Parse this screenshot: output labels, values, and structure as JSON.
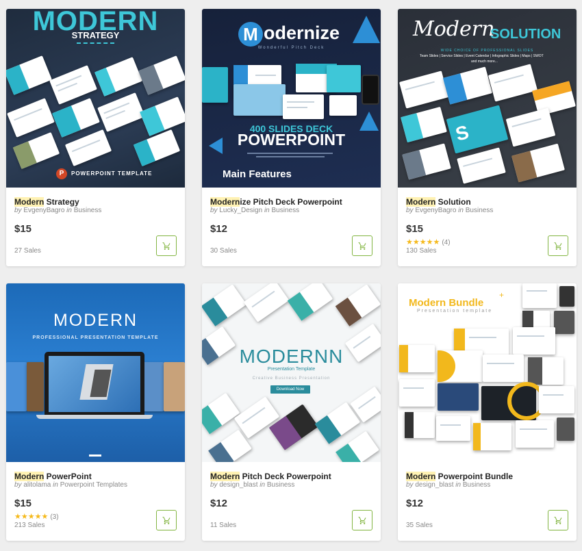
{
  "accent_color": "#82b541",
  "cards": [
    {
      "highlight": "Modern",
      "title_rest": " Strategy",
      "author": "EvgenyBagro",
      "category": "Business",
      "price": "$15",
      "sales": "27 Sales",
      "thumb": {
        "heading": "MODERN",
        "sub": "STRATEGY",
        "footer": "POWERPOINT TEMPLATE"
      }
    },
    {
      "highlight": "Modern",
      "title_rest": "ize Pitch Deck Powerpoint",
      "author": "Lucky_Design",
      "category": "Business",
      "price": "$12",
      "sales": "30 Sales",
      "thumb": {
        "logo": "M",
        "heading": "odernize",
        "sub": "Wonderful Pitch Deck",
        "banner1": "400 SLIDES DECK",
        "banner2": "POWERPOINT",
        "footer": "Main Features"
      }
    },
    {
      "highlight": "Modern",
      "title_rest": " Solution",
      "author": "EvgenyBagro",
      "category": "Business",
      "price": "$15",
      "rating": 5,
      "rating_count": "(4)",
      "sales": "130 Sales",
      "thumb": {
        "heading": "Modern",
        "heading2": "SOLUTION",
        "sub": "WIDE CHOICE OF PROFESSIONAL SLIDES",
        "line1": "Team Slides | Service Slides | Event Calendar | Infographic Slides | Maps | SWOT",
        "line2": "and much more..."
      }
    },
    {
      "highlight": "Modern",
      "title_rest": " PowerPoint",
      "author": "alitolama",
      "category": "Powerpoint Templates",
      "price": "$15",
      "rating": 5,
      "rating_count": "(3)",
      "sales": "213 Sales",
      "thumb": {
        "heading": "MODERN",
        "sub": "PROFESSIONAL PRESENTATION TEMPLATE"
      }
    },
    {
      "highlight": "Modern",
      "title_rest": " Pitch Deck Powerpoint",
      "author": "design_blast",
      "category": "Business",
      "price": "$12",
      "sales": "11 Sales",
      "thumb": {
        "heading": "MODERNN",
        "sub": "Presentation Template",
        "tagline": "Creative Business Presentation",
        "button": "Download Now"
      }
    },
    {
      "highlight": "Modern",
      "title_rest": " Powerpoint Bundle",
      "author": "design_blast",
      "category": "Business",
      "price": "$12",
      "sales": "35 Sales",
      "thumb": {
        "heading": "Modern Bundle",
        "sub": "Presentation template"
      }
    }
  ]
}
